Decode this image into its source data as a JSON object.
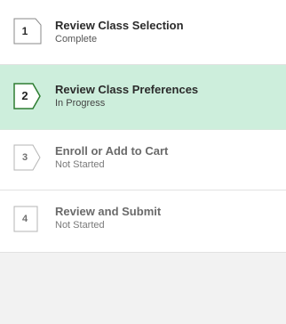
{
  "steps": [
    {
      "number": "1",
      "title": "Review Class Selection",
      "status": "Complete"
    },
    {
      "number": "2",
      "title": "Review Class Preferences",
      "status": "In Progress"
    },
    {
      "number": "3",
      "title": "Enroll or Add to Cart",
      "status": "Not Started"
    },
    {
      "number": "4",
      "title": "Review and Submit",
      "status": "Not Started"
    }
  ],
  "colors": {
    "active_background": "#cdeedc",
    "active_marker_border": "#2e7d32",
    "background": "#f2f2f2"
  }
}
